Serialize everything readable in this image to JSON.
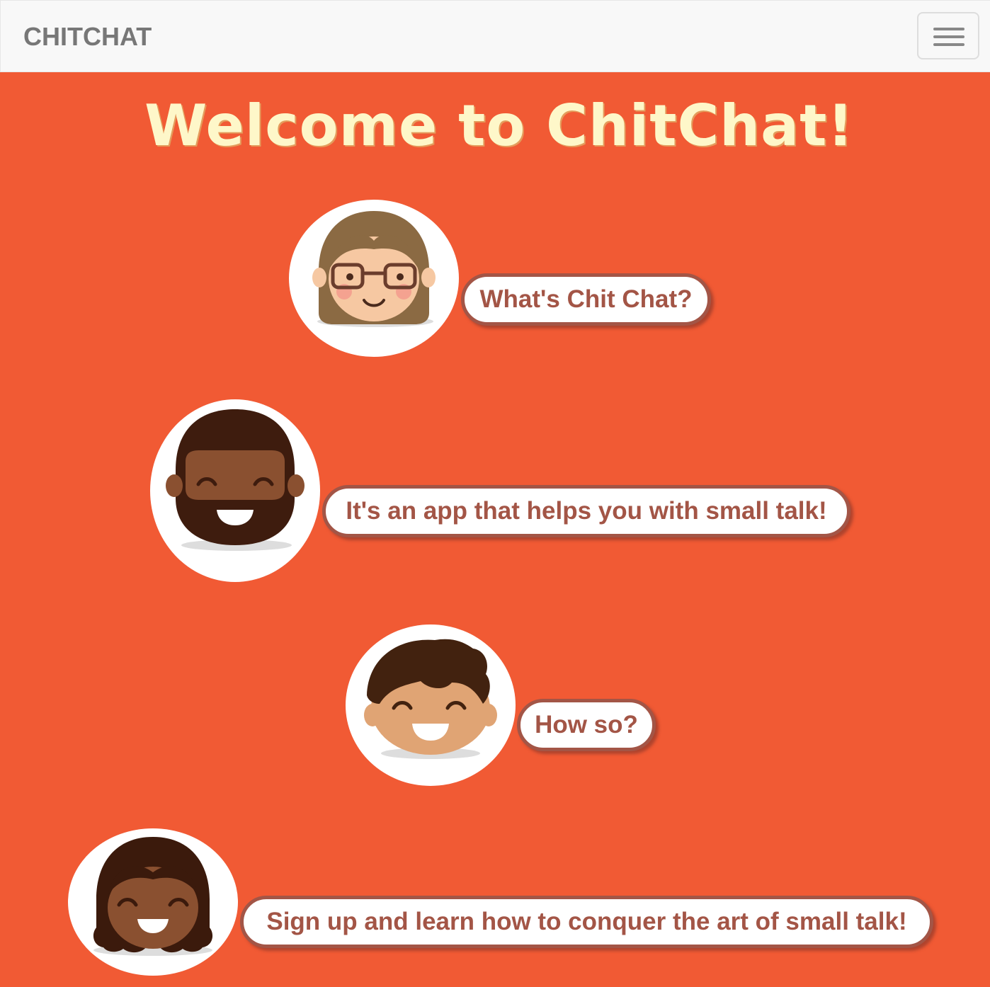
{
  "navbar": {
    "brand": "CHITCHAT",
    "toggle_icon": "hamburger-menu-icon"
  },
  "hero": {
    "title": "Welcome to ChitChat!"
  },
  "conversation": [
    {
      "avatar": "woman-with-glasses-avatar",
      "message": "What's Chit Chat?"
    },
    {
      "avatar": "bearded-man-avatar",
      "message": "It's an app that helps you with small talk!"
    },
    {
      "avatar": "boy-avatar",
      "message": "How so?"
    },
    {
      "avatar": "woman-curly-hair-avatar",
      "message": "Sign up and learn how to conquer the art of small talk!"
    }
  ],
  "colors": {
    "background": "#f15a34",
    "title": "#fef7c9",
    "bubble_text": "#a35546",
    "navbar": "#f8f8f8"
  }
}
